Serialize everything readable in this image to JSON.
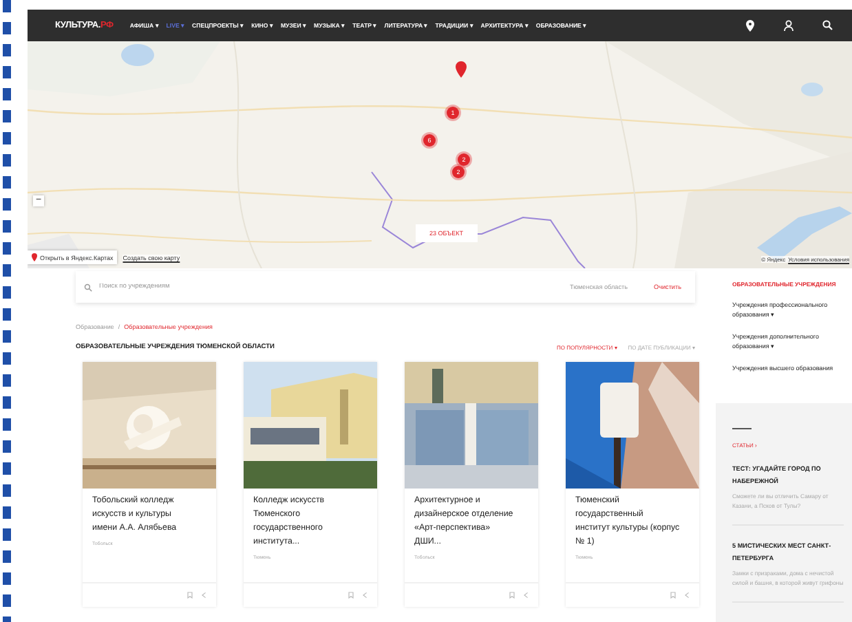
{
  "nav": {
    "logo": "КУЛЬТУРА.РФ",
    "items": [
      {
        "label": "АФИША ▾",
        "selected": false
      },
      {
        "label": "LIVE ▾",
        "selected": true
      },
      {
        "label": "СПЕЦПРОЕКТЫ ▾",
        "selected": false
      },
      {
        "label": "КИНО ▾",
        "selected": false
      },
      {
        "label": "МУЗЕИ ▾",
        "selected": false
      },
      {
        "label": "МУЗЫКА ▾",
        "selected": false
      },
      {
        "label": "ТЕАТР ▾",
        "selected": false
      },
      {
        "label": "ЛИТЕРАТУРА ▾",
        "selected": false
      },
      {
        "label": "ТРАДИЦИИ ▾",
        "selected": false
      },
      {
        "label": "АРХИТЕКТУРА ▾",
        "selected": false
      },
      {
        "label": "ОБРАЗОВАНИЕ ▾",
        "selected": false
      }
    ]
  },
  "map": {
    "markers": [
      {
        "kind": "pin"
      },
      {
        "kind": "cluster",
        "count": "1"
      },
      {
        "kind": "cluster",
        "count": "6"
      },
      {
        "kind": "cluster",
        "count": "2"
      },
      {
        "kind": "cluster",
        "count": "2"
      }
    ],
    "zoom_out": "−",
    "objects_label": "23 ОБЪЕКТ",
    "open_link": "Открыть в Яндекс.Картах",
    "create_link": "Создать свою карту",
    "copyright": "© Яндекс",
    "terms_link": "Условия использования"
  },
  "search": {
    "placeholder": "Поиск по учреждениям",
    "region": "Тюменская область",
    "clear": "Очистить"
  },
  "breadcrumbs": [
    "Образование",
    "Образовательные учреждения"
  ],
  "breadcrumb_separator": "/",
  "heading": "ОБРАЗОВАТЕЛЬНЫЕ УЧРЕЖДЕНИЯ ТЮМЕНСКОЙ ОБЛАСТИ",
  "sort": [
    {
      "label": "ПО ПОПУЛЯРНОСТИ ▾",
      "selected": true
    },
    {
      "label": "ПО ДАТЕ ПУБЛИКАЦИИ ▾",
      "selected": false
    }
  ],
  "cards": [
    {
      "title": "Тобольский колледж искусств и культуры имени А.А. Алябьева",
      "city": "Тобольск"
    },
    {
      "title": "Колледж искусств Тюменского государственного института...",
      "city": "Тюмень"
    },
    {
      "title": "Архитектурное и дизайнерское отделение «Арт-перспектива» ДШИ...",
      "city": "Тобольск"
    },
    {
      "title": "Тюменский государственный институт культуры (корпус № 1)",
      "city": "Тюмень"
    }
  ],
  "sidebar": {
    "title": "ОБРАЗОВАТЕЛЬНЫЕ УЧРЕЖДЕНИЯ",
    "items": [
      {
        "label": "Учреждения профессионального образования ▾"
      },
      {
        "label": "Учреждения дополнительного образования ▾"
      },
      {
        "label": "Учреждения высшего образования"
      }
    ],
    "articles_link": "СТАТЬИ ›",
    "articles": [
      {
        "title": "ТЕСТ: УГАДАЙТЕ ГОРОД ПО НАБЕРЕЖНОЙ",
        "text": "Сможете ли вы отличить Самару от Казани, а Псков от Тулы?"
      },
      {
        "title": "5 МИСТИЧЕСКИХ МЕСТ САНКТ-ПЕТЕРБУРГА",
        "text": "Замки с призраками, дома с нечистой силой и башня, в которой живут грифоны"
      }
    ]
  }
}
